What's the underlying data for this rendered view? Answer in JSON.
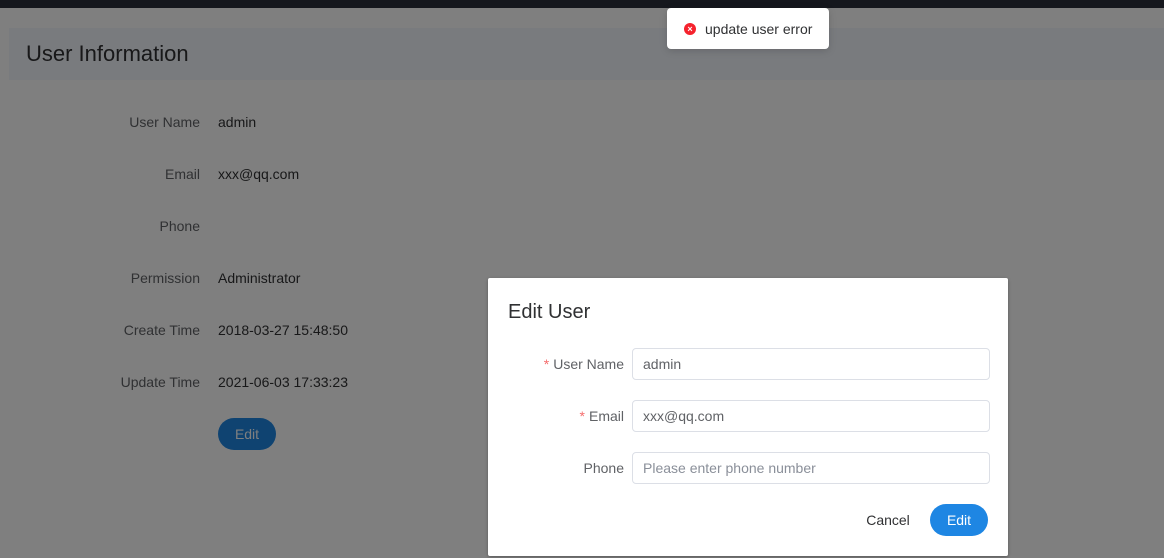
{
  "page": {
    "title": "User Information",
    "fields": [
      {
        "label": "User Name",
        "value": "admin"
      },
      {
        "label": "Email",
        "value": "xxx@qq.com"
      },
      {
        "label": "Phone",
        "value": ""
      },
      {
        "label": "Permission",
        "value": "Administrator"
      },
      {
        "label": "Create Time",
        "value": "2018-03-27 15:48:50"
      },
      {
        "label": "Update Time",
        "value": "2021-06-03 17:33:23"
      }
    ],
    "edit_label": "Edit"
  },
  "dialog": {
    "title": "Edit User",
    "required_mark": "*",
    "user_name": {
      "label": "User Name",
      "value": "admin"
    },
    "email": {
      "label": "Email",
      "value": "xxx@qq.com"
    },
    "phone": {
      "label": "Phone",
      "value": "",
      "placeholder": "Please enter phone number"
    },
    "cancel_label": "Cancel",
    "edit_label": "Edit"
  },
  "toast": {
    "icon": "error-circle-icon",
    "icon_glyph": "×",
    "text": "update user error"
  },
  "colors": {
    "primary": "#1e86e3",
    "error": "#f5222d",
    "required": "#f56c6c"
  }
}
